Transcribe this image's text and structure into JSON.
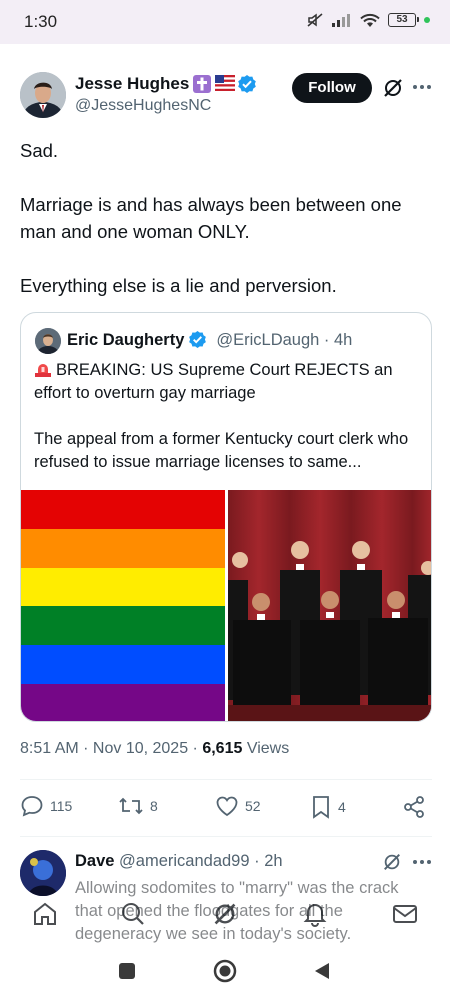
{
  "status_bar": {
    "time": "1:30",
    "battery": "53",
    "icons": [
      "mute-icon",
      "signal-icon",
      "wifi-icon",
      "battery-icon",
      "privacy-dot-icon"
    ]
  },
  "post": {
    "author_name": "Jesse Hughes",
    "author_handle": "@JesseHughesNC",
    "author_badges": [
      "cross-emoji-icon",
      "us-flag-emoji-icon",
      "verified-icon"
    ],
    "follow_label": "Follow",
    "text_paragraphs": [
      "Sad.",
      "Marriage is and has always been between one man and one woman ONLY.",
      "Everything else is a lie and perversion."
    ],
    "quote": {
      "author_name": "Eric Daugherty",
      "author_handle": "@EricLDaugh · 4h",
      "paragraph_1": "BREAKING: US Supreme Court REJECTS an effort to overturn gay marriage",
      "paragraph_2": "The appeal from a former Kentucky court clerk who refused to issue marriage licenses to same...",
      "flag_colors": [
        "#e40303",
        "#ff8c00",
        "#ffed00",
        "#008026",
        "#004dff",
        "#750787"
      ]
    },
    "meta": {
      "time": "8:51 AM",
      "sep1": " · ",
      "date": "Nov 10, 2025",
      "sep2": " · ",
      "views_count": "6,615",
      "views_label": " Views"
    },
    "actions": {
      "replies": "115",
      "reposts": "8",
      "likes": "52",
      "bookmarks": "4"
    }
  },
  "reply": {
    "author_name": "Dave",
    "author_handle": "@americandad99 · 2h",
    "text": "Allowing sodomites to \"marry\" was the crack that opened the floodgates for all the degeneracy we see in today's society."
  },
  "tabbar": [
    "home-icon",
    "search-icon",
    "grok-icon",
    "notifications-icon",
    "messages-icon"
  ],
  "navbar": [
    "recents-button",
    "home-button",
    "back-button"
  ],
  "colors": {
    "text": "#0f1419",
    "secondary": "#536471",
    "verified": "#1d9bf0",
    "border": "#cfd9de"
  }
}
